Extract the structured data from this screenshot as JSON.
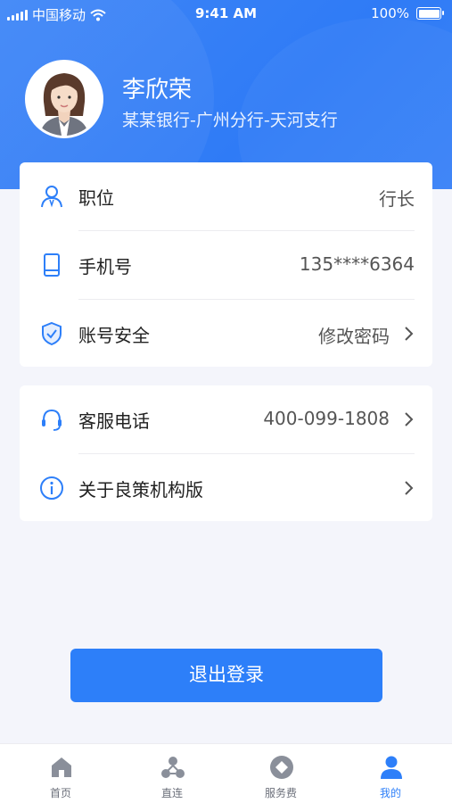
{
  "status_bar": {
    "carrier": "中国移动",
    "time": "9:41 AM",
    "battery": "100%"
  },
  "profile": {
    "name": "李欣荣",
    "org": "某某银行-广州分行-天河支行",
    "avatar_icon": "user-avatar"
  },
  "info_card": {
    "rows": [
      {
        "label": "职位",
        "value": "行长",
        "icon": "user-icon"
      },
      {
        "label": "手机号",
        "value": "135****6364",
        "icon": "phone-icon"
      },
      {
        "label": "账号安全",
        "value": "修改密码",
        "icon": "shield-icon"
      }
    ]
  },
  "support_card": {
    "rows": [
      {
        "label": "客服电话",
        "value": "400-099-1808",
        "icon": "headset-icon"
      },
      {
        "label": "关于良策机构版",
        "icon": "info-icon"
      }
    ]
  },
  "logout": {
    "label": "退出登录"
  },
  "tabbar": {
    "tabs": [
      {
        "label": "首页",
        "icon": "home-icon"
      },
      {
        "label": "直连",
        "icon": "connect-icon"
      },
      {
        "label": "服务费",
        "icon": "service-fee-icon"
      },
      {
        "label": "我的",
        "icon": "profile-icon",
        "active": true
      }
    ]
  },
  "colors": {
    "primary": "#2d7ff9",
    "header": "#3a82f7",
    "background": "#f4f5fb"
  }
}
